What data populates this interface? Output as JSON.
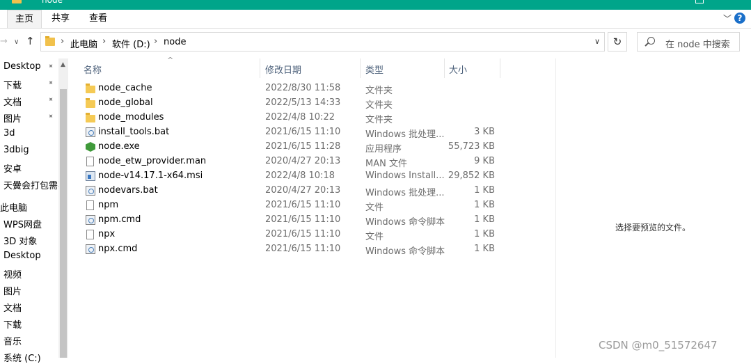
{
  "window": {
    "title": "node"
  },
  "ribbon": {
    "tabs": [
      {
        "label": "主页"
      },
      {
        "label": "共享"
      },
      {
        "label": "查看"
      }
    ],
    "expand_glyph": "﹀",
    "help_glyph": "?"
  },
  "address_bar": {
    "nav_back_glyph": "→",
    "nav_recent_glyph": "∨",
    "nav_up_glyph": "↑",
    "crumbs": [
      "此电脑",
      "软件 (D:)",
      "node"
    ],
    "separator": "›",
    "dropdown_glyph": "∨",
    "refresh_glyph": "↻"
  },
  "search": {
    "placeholder": "在 node 中搜索"
  },
  "nav_pane": {
    "items": [
      {
        "label": "Desktop",
        "pinned": true
      },
      {
        "label": "下载",
        "pinned": true
      },
      {
        "label": "文档",
        "pinned": true
      },
      {
        "label": "图片",
        "pinned": true
      },
      {
        "label": "3d"
      },
      {
        "label": "3dbig"
      },
      {
        "label": "安卓"
      },
      {
        "label": "天黌会打包需要"
      },
      {
        "label": "此电脑",
        "root": true
      },
      {
        "label": "WPS网盘"
      },
      {
        "label": "3D 对象"
      },
      {
        "label": "Desktop"
      },
      {
        "label": "视频"
      },
      {
        "label": "图片"
      },
      {
        "label": "文档"
      },
      {
        "label": "下载"
      },
      {
        "label": "音乐"
      },
      {
        "label": "系统 (C:)"
      }
    ],
    "pin_glyph": "📌"
  },
  "file_list": {
    "sort_glyph": "^",
    "columns": {
      "name": "名称",
      "date": "修改日期",
      "type": "类型",
      "size": "大小"
    },
    "rows": [
      {
        "name": "node_cache",
        "date": "2022/8/30 11:58",
        "type": "文件夹",
        "size": "",
        "icon": "folder-icon"
      },
      {
        "name": "node_global",
        "date": "2022/5/13 14:33",
        "type": "文件夹",
        "size": "",
        "icon": "folder-icon"
      },
      {
        "name": "node_modules",
        "date": "2022/4/8 10:22",
        "type": "文件夹",
        "size": "",
        "icon": "folder-icon"
      },
      {
        "name": "install_tools.bat",
        "date": "2021/6/15 11:10",
        "type": "Windows 批处理...",
        "size": "3 KB",
        "icon": "batch-file-icon"
      },
      {
        "name": "node.exe",
        "date": "2021/6/15 11:28",
        "type": "应用程序",
        "size": "55,723 KB",
        "icon": "node-exe-icon"
      },
      {
        "name": "node_etw_provider.man",
        "date": "2020/4/27 20:13",
        "type": "MAN 文件",
        "size": "9 KB",
        "icon": "file-icon"
      },
      {
        "name": "node-v14.17.1-x64.msi",
        "date": "2022/4/8 10:18",
        "type": "Windows Install...",
        "size": "29,852 KB",
        "icon": "installer-icon"
      },
      {
        "name": "nodevars.bat",
        "date": "2020/4/27 20:13",
        "type": "Windows 批处理...",
        "size": "1 KB",
        "icon": "batch-file-icon"
      },
      {
        "name": "npm",
        "date": "2021/6/15 11:10",
        "type": "文件",
        "size": "1 KB",
        "icon": "file-icon"
      },
      {
        "name": "npm.cmd",
        "date": "2021/6/15 11:10",
        "type": "Windows 命令脚本",
        "size": "1 KB",
        "icon": "batch-file-icon"
      },
      {
        "name": "npx",
        "date": "2021/6/15 11:10",
        "type": "文件",
        "size": "1 KB",
        "icon": "file-icon"
      },
      {
        "name": "npx.cmd",
        "date": "2021/6/15 11:10",
        "type": "Windows 命令脚本",
        "size": "1 KB",
        "icon": "batch-file-icon"
      }
    ]
  },
  "preview": {
    "empty_text": "选择要预览的文件。"
  },
  "watermark": "CSDN @m0_51572647",
  "colors": {
    "titlebar": "#00a58a",
    "folder": "#f5ca55",
    "header_text": "#4c607a",
    "help": "#1a6fc9"
  }
}
